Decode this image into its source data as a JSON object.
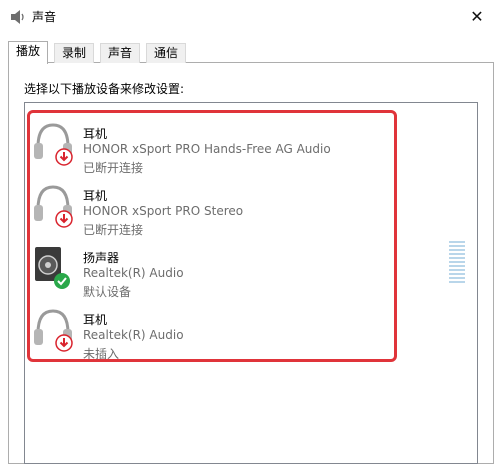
{
  "window": {
    "title": "声音",
    "app_icon": "speaker-app-icon",
    "close_glyph": "✕"
  },
  "tabs": [
    {
      "label": "播放",
      "active": true
    },
    {
      "label": "录制",
      "active": false
    },
    {
      "label": "声音",
      "active": false
    },
    {
      "label": "通信",
      "active": false
    }
  ],
  "instruction": "选择以下播放设备来修改设置:",
  "devices": [
    {
      "name": "耳机",
      "description": "HONOR xSport PRO Hands-Free AG Audio",
      "status": "已断开连接",
      "icon": "headphones-icon",
      "badge": "red-down-arrow"
    },
    {
      "name": "耳机",
      "description": "HONOR xSport PRO Stereo",
      "status": "已断开连接",
      "icon": "headphones-icon",
      "badge": "red-down-arrow"
    },
    {
      "name": "扬声器",
      "description": "Realtek(R) Audio",
      "status": "默认设备",
      "icon": "speaker-icon",
      "badge": "green-check"
    },
    {
      "name": "耳机",
      "description": "Realtek(R) Audio",
      "status": "未插入",
      "icon": "headphones-icon",
      "badge": "red-down-arrow"
    }
  ],
  "colors": {
    "highlight_border": "#e0343a",
    "disconnected_badge": "#d9232d",
    "default_badge": "#2aa84a",
    "level_meter": "#b9d6ea"
  }
}
